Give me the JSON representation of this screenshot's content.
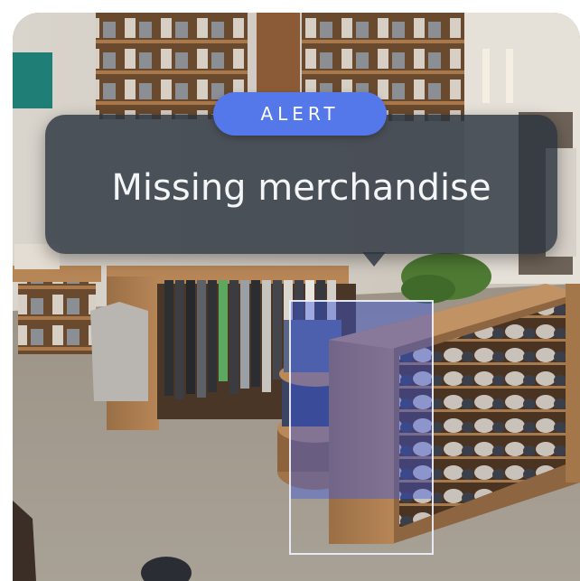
{
  "alert": {
    "badge_label": "ALERT",
    "message": "Missing merchandise"
  },
  "colors": {
    "badge": "#5477ea",
    "panel": "#2c3440",
    "highlight": "#3a58e4"
  }
}
